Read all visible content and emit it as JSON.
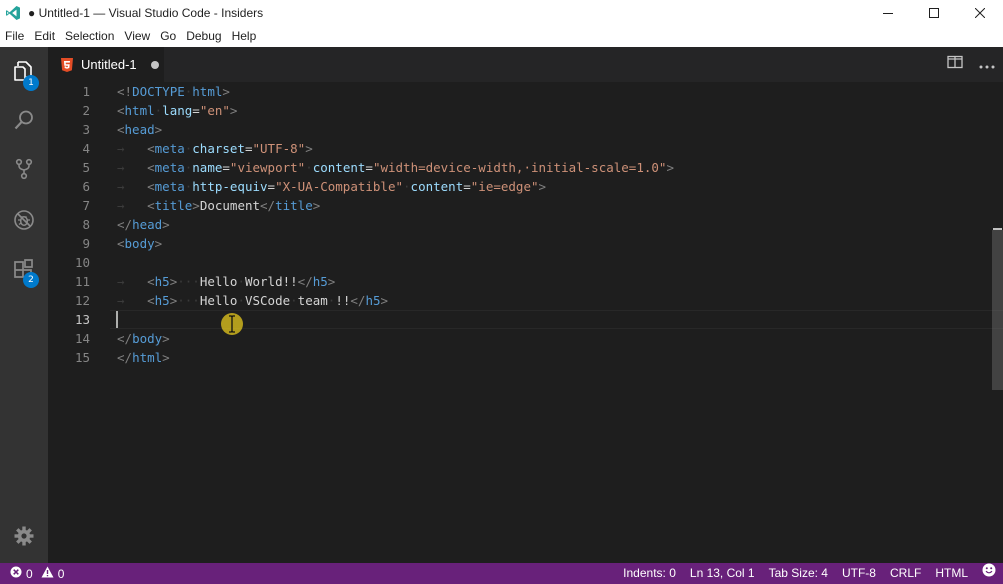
{
  "window": {
    "title": "● Untitled-1 — Visual Studio Code - Insiders"
  },
  "menu": [
    "File",
    "Edit",
    "Selection",
    "View",
    "Go",
    "Debug",
    "Help"
  ],
  "activity_bar": {
    "items": [
      {
        "icon": "files-icon",
        "badge": "1"
      },
      {
        "icon": "search-icon",
        "badge": ""
      },
      {
        "icon": "source-control-icon",
        "badge": ""
      },
      {
        "icon": "debug-icon",
        "badge": ""
      },
      {
        "icon": "extensions-icon",
        "badge": "2"
      }
    ],
    "settings_icon": "gear-icon"
  },
  "tab": {
    "label": "Untitled-1",
    "language_icon": "html5-icon",
    "dirty": true
  },
  "editor": {
    "lines": [
      {
        "n": "1",
        "tokens": [
          [
            "br",
            "<!"
          ],
          [
            "tag",
            "DOCTYPE"
          ],
          [
            "ws",
            "·"
          ],
          [
            "tag",
            "html"
          ],
          [
            "br",
            ">"
          ]
        ]
      },
      {
        "n": "2",
        "tokens": [
          [
            "br",
            "<"
          ],
          [
            "tag",
            "html"
          ],
          [
            "ws",
            "·"
          ],
          [
            "attr",
            "lang"
          ],
          [
            "txt",
            "="
          ],
          [
            "str",
            "\"en\""
          ],
          [
            "br",
            ">"
          ]
        ]
      },
      {
        "n": "3",
        "tokens": [
          [
            "br",
            "<"
          ],
          [
            "tag",
            "head"
          ],
          [
            "br",
            ">"
          ]
        ]
      },
      {
        "n": "4",
        "tokens": [
          [
            "ws",
            "→   "
          ],
          [
            "br",
            "<"
          ],
          [
            "tag",
            "meta"
          ],
          [
            "ws",
            "·"
          ],
          [
            "attr",
            "charset"
          ],
          [
            "txt",
            "="
          ],
          [
            "str",
            "\"UTF-8\""
          ],
          [
            "br",
            ">"
          ]
        ]
      },
      {
        "n": "5",
        "tokens": [
          [
            "ws",
            "→   "
          ],
          [
            "br",
            "<"
          ],
          [
            "tag",
            "meta"
          ],
          [
            "ws",
            "·"
          ],
          [
            "attr",
            "name"
          ],
          [
            "txt",
            "="
          ],
          [
            "str",
            "\"viewport\""
          ],
          [
            "ws",
            "·"
          ],
          [
            "attr",
            "content"
          ],
          [
            "txt",
            "="
          ],
          [
            "str",
            "\"width=device-width,·initial-scale=1.0\""
          ],
          [
            "br",
            ">"
          ]
        ]
      },
      {
        "n": "6",
        "tokens": [
          [
            "ws",
            "→   "
          ],
          [
            "br",
            "<"
          ],
          [
            "tag",
            "meta"
          ],
          [
            "ws",
            "·"
          ],
          [
            "attr",
            "http-equiv"
          ],
          [
            "txt",
            "="
          ],
          [
            "str",
            "\"X-UA-Compatible\""
          ],
          [
            "ws",
            "·"
          ],
          [
            "attr",
            "content"
          ],
          [
            "txt",
            "="
          ],
          [
            "str",
            "\"ie=edge\""
          ],
          [
            "br",
            ">"
          ]
        ]
      },
      {
        "n": "7",
        "tokens": [
          [
            "ws",
            "→   "
          ],
          [
            "br",
            "<"
          ],
          [
            "tag",
            "title"
          ],
          [
            "br",
            ">"
          ],
          [
            "txt",
            "Document"
          ],
          [
            "br",
            "</"
          ],
          [
            "tag",
            "title"
          ],
          [
            "br",
            ">"
          ]
        ]
      },
      {
        "n": "8",
        "tokens": [
          [
            "br",
            "</"
          ],
          [
            "tag",
            "head"
          ],
          [
            "br",
            ">"
          ]
        ]
      },
      {
        "n": "9",
        "tokens": [
          [
            "br",
            "<"
          ],
          [
            "tag",
            "body"
          ],
          [
            "br",
            ">"
          ]
        ]
      },
      {
        "n": "10",
        "tokens": []
      },
      {
        "n": "11",
        "tokens": [
          [
            "ws",
            "→   "
          ],
          [
            "br",
            "<"
          ],
          [
            "tag",
            "h5"
          ],
          [
            "br",
            ">"
          ],
          [
            "ws",
            "···"
          ],
          [
            "txt",
            "Hello"
          ],
          [
            "ws",
            "·"
          ],
          [
            "txt",
            "World!!"
          ],
          [
            "br",
            "</"
          ],
          [
            "tag",
            "h5"
          ],
          [
            "br",
            ">"
          ]
        ]
      },
      {
        "n": "12",
        "tokens": [
          [
            "ws",
            "→   "
          ],
          [
            "br",
            "<"
          ],
          [
            "tag",
            "h5"
          ],
          [
            "br",
            ">"
          ],
          [
            "ws",
            "···"
          ],
          [
            "txt",
            "Hello"
          ],
          [
            "ws",
            "·"
          ],
          [
            "txt",
            "VSCode"
          ],
          [
            "ws",
            "·"
          ],
          [
            "txt",
            "team"
          ],
          [
            "ws",
            "·"
          ],
          [
            "txt",
            "!!"
          ],
          [
            "br",
            "</"
          ],
          [
            "tag",
            "h5"
          ],
          [
            "br",
            ">"
          ]
        ]
      },
      {
        "n": "13",
        "tokens": []
      },
      {
        "n": "14",
        "tokens": [
          [
            "br",
            "</"
          ],
          [
            "tag",
            "body"
          ],
          [
            "br",
            ">"
          ]
        ]
      },
      {
        "n": "15",
        "tokens": [
          [
            "br",
            "</"
          ],
          [
            "tag",
            "html"
          ],
          [
            "br",
            ">"
          ]
        ]
      }
    ],
    "cursor_line": "13"
  },
  "status_bar": {
    "errors": "0",
    "warnings": "0",
    "indents": "Indents: 0",
    "position": "Ln 13, Col 1",
    "tab_size": "Tab Size: 4",
    "encoding": "UTF-8",
    "eol": "CRLF",
    "language": "HTML",
    "feedback_icon": "smiley-icon"
  },
  "colors": {
    "status_bar": "#68217a",
    "activity_bar": "#333333",
    "editor_bg": "#1e1e1e",
    "badge": "#007acc"
  }
}
